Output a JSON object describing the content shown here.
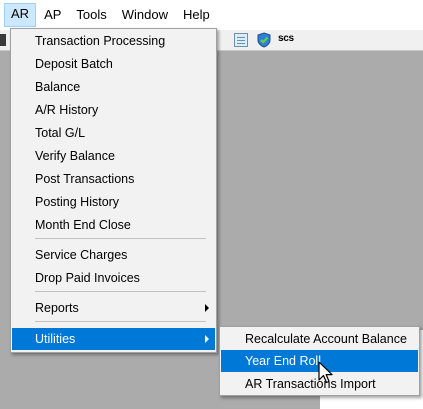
{
  "menubar": {
    "items": [
      "AR",
      "AP",
      "Tools",
      "Window",
      "Help"
    ],
    "active": "AR"
  },
  "toolbar": {
    "text": "scs",
    "icons": [
      "notepad-icon",
      "shield-check-icon"
    ]
  },
  "ar_menu": {
    "items": [
      {
        "label": "Transaction Processing"
      },
      {
        "label": "Deposit Batch"
      },
      {
        "label": "Balance"
      },
      {
        "label": "A/R History"
      },
      {
        "label": "Total G/L"
      },
      {
        "label": "Verify Balance"
      },
      {
        "label": "Post Transactions"
      },
      {
        "label": "Posting History"
      },
      {
        "label": "Month End Close"
      },
      {
        "label": "Service Charges"
      },
      {
        "label": "Drop Paid Invoices"
      },
      {
        "label": "Reports",
        "submenu": true
      },
      {
        "label": "Utilities",
        "submenu": true,
        "highlighted": true
      }
    ]
  },
  "utilities_submenu": {
    "items": [
      {
        "label": "Recalculate Account Balance"
      },
      {
        "label": "Year End Roll",
        "highlighted": true
      },
      {
        "label": "AR Transactions Import"
      }
    ]
  },
  "colors": {
    "highlight": "#0078d7",
    "menu_bg": "#f2f2f2",
    "workspace": "#ababab",
    "menubar_active": "#cce8ff"
  }
}
